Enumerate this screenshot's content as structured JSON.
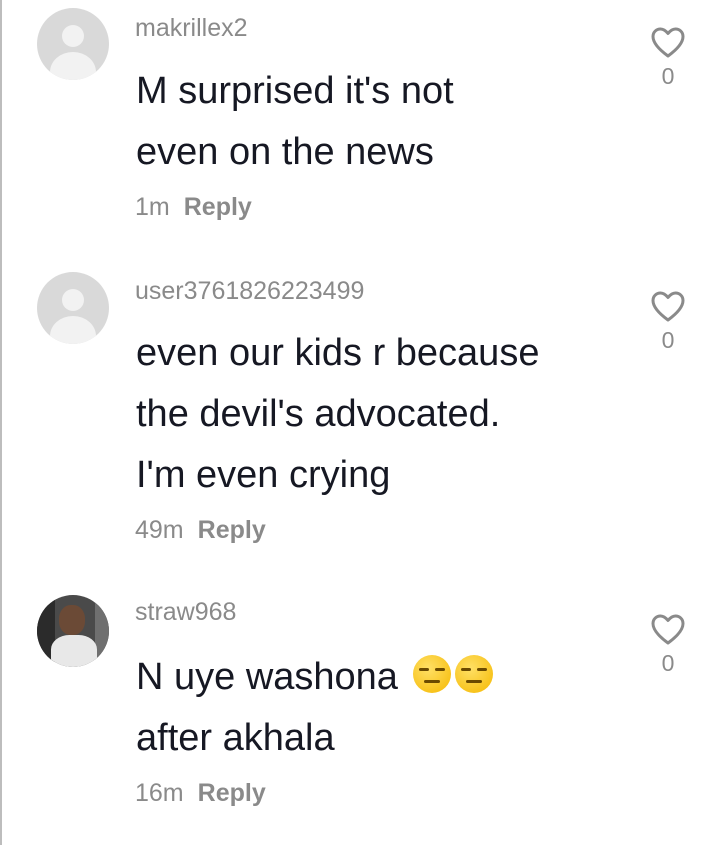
{
  "comments": [
    {
      "username": "makrillex2",
      "lines": [
        "M surprised it's not",
        "even on the news"
      ],
      "time": "1m",
      "reply_label": "Reply",
      "likes": "0",
      "avatar": "default-avatar"
    },
    {
      "username": "user3761826223499",
      "lines": [
        "even our kids r because",
        "the devil's advocated.",
        "I'm even crying"
      ],
      "time": "49m",
      "reply_label": "Reply",
      "likes": "0",
      "avatar": "default-avatar"
    },
    {
      "username": "straw968",
      "lines": [
        "N uye washona",
        "after akhala"
      ],
      "emojis": [
        "expressionless-face",
        "expressionless-face"
      ],
      "time": "16m",
      "reply_label": "Reply",
      "likes": "0",
      "avatar": "photo-avatar"
    }
  ],
  "icons": {
    "like": "heart-outline-icon"
  },
  "colors": {
    "text": "#161823",
    "secondary": "#8a8a8a",
    "avatar_placeholder": "#d9d9d9"
  }
}
